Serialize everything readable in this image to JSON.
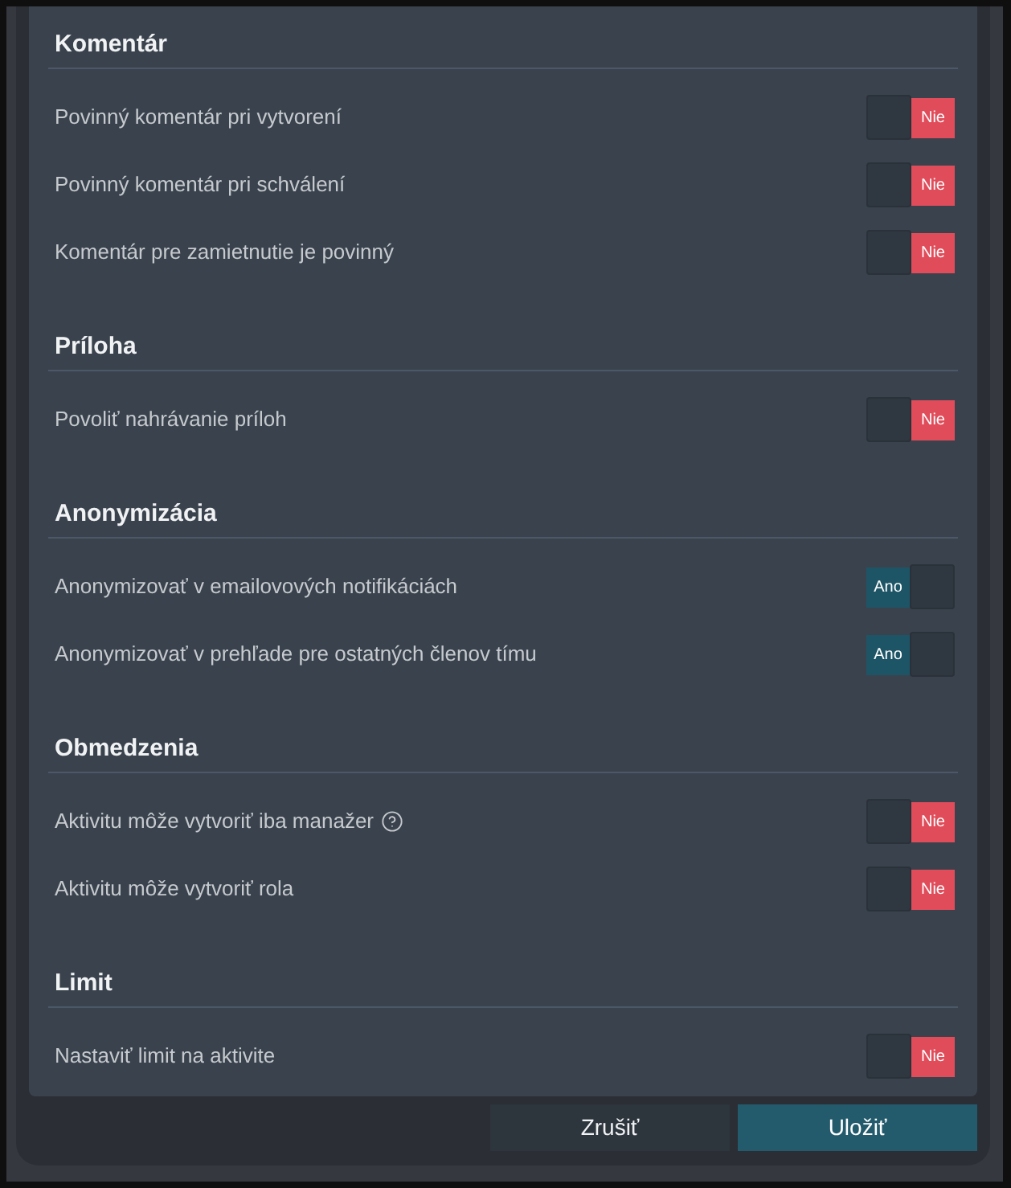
{
  "sections": [
    {
      "title": "Komentár",
      "settings": [
        {
          "label": "Povinný komentár pri vytvorení",
          "help": false,
          "on": false,
          "value_text": "Nie"
        },
        {
          "label": "Povinný komentár pri schválení",
          "help": false,
          "on": false,
          "value_text": "Nie"
        },
        {
          "label": "Komentár pre zamietnutie je povinný",
          "help": false,
          "on": false,
          "value_text": "Nie"
        }
      ]
    },
    {
      "title": "Príloha",
      "settings": [
        {
          "label": "Povoliť nahrávanie príloh",
          "help": false,
          "on": false,
          "value_text": "Nie"
        }
      ]
    },
    {
      "title": "Anonymizácia",
      "settings": [
        {
          "label": "Anonymizovať v emailovových notifikáciách",
          "help": false,
          "on": true,
          "value_text": "Ano"
        },
        {
          "label": "Anonymizovať v prehľade pre ostatných členov tímu",
          "help": false,
          "on": true,
          "value_text": "Ano"
        }
      ]
    },
    {
      "title": "Obmedzenia",
      "settings": [
        {
          "label": "Aktivitu môže vytvoriť iba manažer",
          "help": true,
          "on": false,
          "value_text": "Nie"
        },
        {
          "label": "Aktivitu môže vytvoriť rola",
          "help": false,
          "on": false,
          "value_text": "Nie"
        }
      ]
    },
    {
      "title": "Limit",
      "settings": [
        {
          "label": "Nastaviť limit na aktivite",
          "help": false,
          "on": false,
          "value_text": "Nie"
        }
      ]
    }
  ],
  "buttons": [
    {
      "label": "Zrušiť",
      "kind": "secondary"
    },
    {
      "label": "Uložiť",
      "kind": "primary"
    }
  ]
}
